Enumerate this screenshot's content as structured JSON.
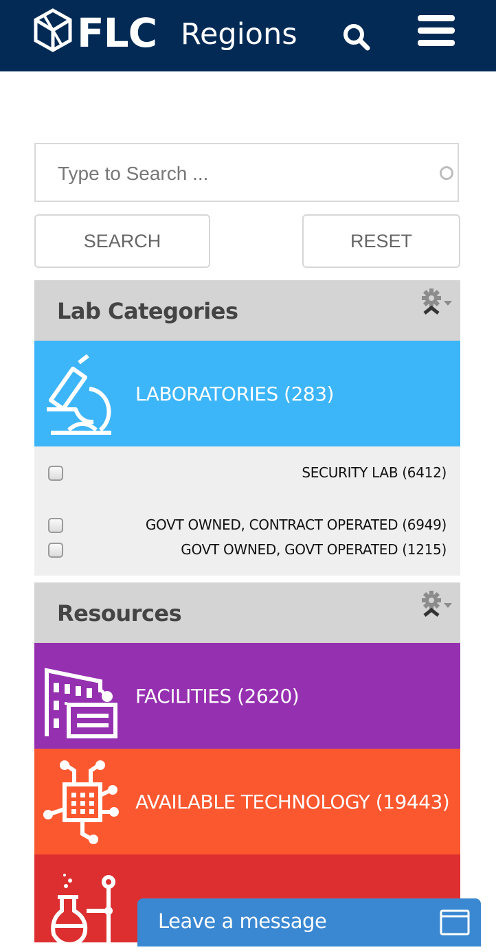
{
  "header": {
    "logo_text": "FLC",
    "title": "Regions",
    "icons": {
      "logo": "flc-cube-logo",
      "search": "search-icon",
      "menu": "hamburger-menu-icon"
    },
    "background_color": "#022a55"
  },
  "search": {
    "placeholder": "Type to Search ...",
    "value": "",
    "search_button": "SEARCH",
    "reset_button": "RESET"
  },
  "lab_categories": {
    "title": "Lab Categories",
    "settings_icon": "gear-dropdown-icon",
    "category": {
      "label": "LABORATORIES (283)",
      "icon": "microscope-icon",
      "color": "#3db5f9"
    },
    "options": [
      {
        "label": "SECURITY LAB (6412)",
        "checked": false
      },
      {
        "label": "GOVT OWNED, CONTRACT OPERATED (6949)",
        "checked": false
      },
      {
        "label": "GOVT OWNED, GOVT OPERATED (1215)",
        "checked": false
      }
    ]
  },
  "resources": {
    "title": "Resources",
    "settings_icon": "gear-dropdown-icon",
    "items": [
      {
        "label": "FACILITIES (2620)",
        "icon": "building-icon",
        "color": "#9530b0"
      },
      {
        "label": "AVAILABLE TECHNOLOGY (19443)",
        "icon": "chip-circuit-icon",
        "color": "#fc5830"
      },
      {
        "label": "",
        "icon": "lab-flask-icon",
        "color": "#dd2f30"
      }
    ]
  },
  "chat": {
    "label": "Leave a message",
    "icon": "chat-window-icon",
    "color": "#3b88d2"
  }
}
